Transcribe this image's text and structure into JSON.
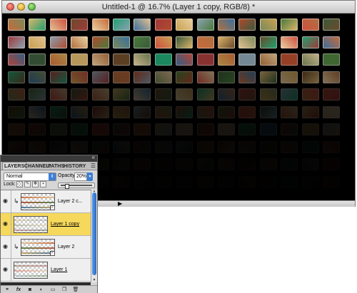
{
  "document": {
    "title": "Untitled-1 @ 16.7% (Layer 1 copy, RGB/8) *",
    "thumbnail_palette": [
      "#c86a3a",
      "#b04a2e",
      "#3a6f9e",
      "#d9b36a",
      "#7a8a5a",
      "#a03a3a",
      "#e0c090",
      "#4a7a3a",
      "#c8a050",
      "#6a4a2a",
      "#d05040",
      "#8aa0b0",
      "#e8d0a0",
      "#3a5a3a",
      "#b07040",
      "#20a070"
    ]
  },
  "layers_panel": {
    "tabs": [
      "LAYERS",
      "CHANNEL!",
      "PATHS",
      "HISTORY"
    ],
    "active_tab": "LAYERS",
    "blend_mode": "Normal",
    "opacity_label": "Opacity:",
    "opacity_value": "20%",
    "opacity_fraction": 0.2,
    "lock_label": "Lock:",
    "layers": [
      {
        "name": "Layer 2 c...",
        "clipped": true,
        "selected": false,
        "underlined": false
      },
      {
        "name": "Layer 1 copy",
        "clipped": false,
        "selected": true,
        "underlined": true
      },
      {
        "name": "Layer 2",
        "clipped": true,
        "selected": false,
        "underlined": false
      },
      {
        "name": "Layer 1",
        "clipped": false,
        "selected": false,
        "underlined": true
      }
    ],
    "footer_buttons": [
      "link-layers",
      "fx",
      "add-mask",
      "adjustment",
      "new-group",
      "new-layer",
      "delete-layer"
    ]
  }
}
